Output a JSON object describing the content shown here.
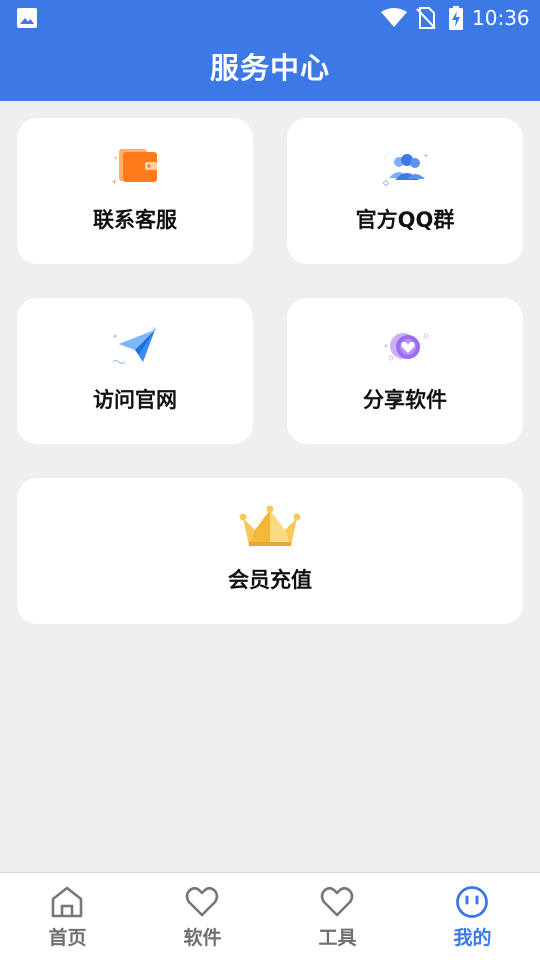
{
  "status_bar": {
    "time": "10:36",
    "icons": [
      "gallery-icon",
      "wifi-icon",
      "no-sim-icon",
      "battery-charging-icon"
    ]
  },
  "header": {
    "title": "服务中心"
  },
  "cards": [
    {
      "label": "联系客服",
      "icon": "wallet-icon"
    },
    {
      "label": "官方QQ群",
      "icon": "group-icon"
    },
    {
      "label": "访问官网",
      "icon": "paper-plane-icon"
    },
    {
      "label": "分享软件",
      "icon": "heart-badge-icon"
    },
    {
      "label": "会员充值",
      "icon": "crown-icon"
    }
  ],
  "nav": [
    {
      "label": "首页",
      "icon": "home-icon",
      "active": false
    },
    {
      "label": "软件",
      "icon": "heart-icon",
      "active": false
    },
    {
      "label": "工具",
      "icon": "heart-icon",
      "active": false
    },
    {
      "label": "我的",
      "icon": "smiley-icon",
      "active": true
    }
  ],
  "colors": {
    "primary": "#3c79e6",
    "background": "#efefef",
    "card": "#ffffff",
    "nav_inactive": "#6f6f6f",
    "wallet_orange": "#ff7a1a",
    "crown_gold": "#f6c95a"
  }
}
